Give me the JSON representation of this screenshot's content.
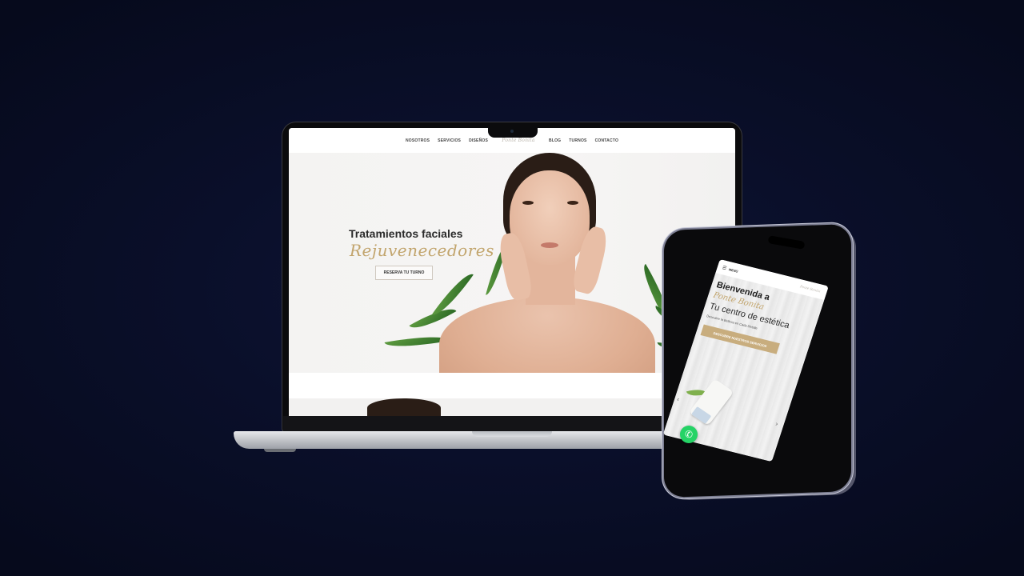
{
  "laptop_site": {
    "nav": {
      "items_left": [
        "NOSOTROS",
        "SERVICIOS",
        "DISEÑOS"
      ],
      "logo": "Ponte Bonita",
      "items_right": [
        "BLOG",
        "TURNOS",
        "CONTACTO"
      ]
    },
    "hero": {
      "title": "Tratamientos faciales",
      "script": "Rejuvenecedores",
      "button": "RESERVA TU TURNO"
    }
  },
  "phone_site": {
    "nav": {
      "menu_icon": "hamburger-icon",
      "menu_label": "MENÚ",
      "logo": "Ponte Bonita"
    },
    "hero": {
      "line1": "Bienvenida a",
      "script": "Ponte Bonita",
      "line2": "Tu centro de estética",
      "small": "Descubre la Belleza en Cada Detalle",
      "button": "DESCUBRE NUESTROS SERVICIOS",
      "prev_arrow": "‹",
      "next_arrow": "›"
    },
    "whatsapp_icon": "whatsapp-icon"
  },
  "colors": {
    "background": "#0a0f2a",
    "accent_gold": "#c2a56d",
    "button_gold": "#c8ad7e",
    "whatsapp_green": "#25d366"
  }
}
